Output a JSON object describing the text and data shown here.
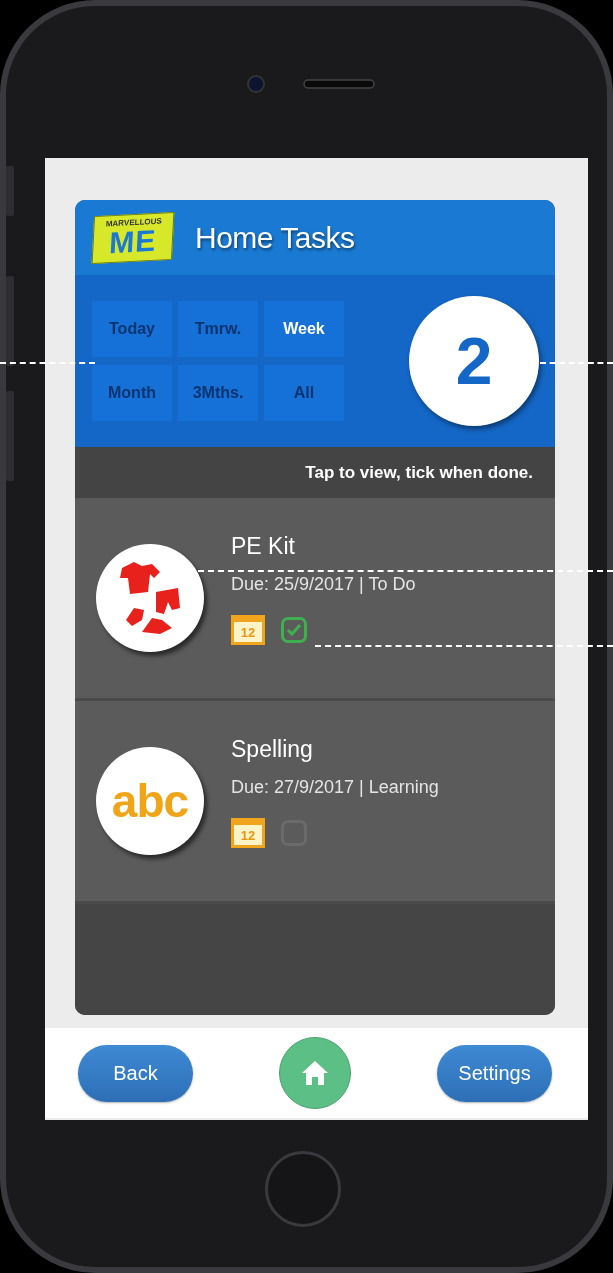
{
  "app": {
    "logo": {
      "top": "MARVELLOUS",
      "main": "ME"
    },
    "title": "Home Tasks"
  },
  "filters": [
    {
      "label": "Today",
      "selected": false
    },
    {
      "label": "Tmrw.",
      "selected": false
    },
    {
      "label": "Week",
      "selected": true
    },
    {
      "label": "Month",
      "selected": false
    },
    {
      "label": "3Mths.",
      "selected": false
    },
    {
      "label": "All",
      "selected": false
    }
  ],
  "count": "2",
  "hint": "Tap to view, tick when done.",
  "tasks": [
    {
      "kind": "kit",
      "title": "PE Kit",
      "due": "Due: 25/9/2017 | To Do",
      "calendar_label": "12",
      "checked": true
    },
    {
      "kind": "letters",
      "picture_text": "abc",
      "title": "Spelling",
      "due": "Due: 27/9/2017 | Learning",
      "calendar_label": "12",
      "checked": false
    }
  ],
  "nav": {
    "back": "Back",
    "settings": "Settings"
  }
}
